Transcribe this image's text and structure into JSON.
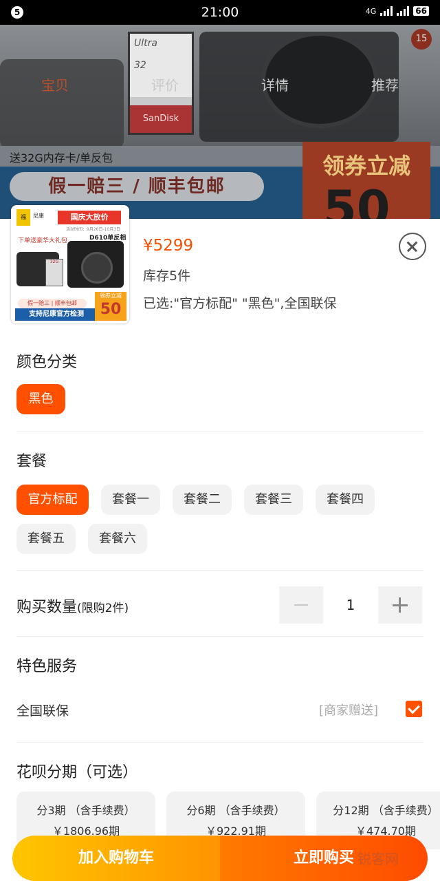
{
  "status_bar": {
    "badge": "5",
    "time": "21:00",
    "network": "4G",
    "battery": "66"
  },
  "background_page": {
    "sd_brand": "Ultra",
    "sd_size": "32",
    "sd_maker": "SanDisk",
    "cart_count": "15",
    "nav": [
      "宝贝",
      "评价",
      "详情",
      "推荐"
    ],
    "gift_line": "送32G内存卡/单反包",
    "promo_pill": "假一赔三 / 顺丰包邮",
    "coupon_title": "领券立减",
    "coupon_value": "50"
  },
  "product": {
    "thumb": {
      "logo": "福",
      "brand": "尼康",
      "banner": "国庆大放价",
      "date": "活动时间：9月26日-10月3日",
      "gift": "下单送豪华大礼包",
      "model": "D610单反相机",
      "sd": "32G",
      "tag1": "假一赔三 | 顺丰包邮",
      "tag2": "支持尼康官方检测",
      "coupon_label": "领券立减",
      "coupon_value": "50"
    },
    "price": "¥5299",
    "stock": "库存5件",
    "selected": "已选:\"官方标配\" \"黑色\",全国联保"
  },
  "color": {
    "title": "颜色分类",
    "options": [
      "黑色"
    ]
  },
  "package": {
    "title": "套餐",
    "options": [
      "官方标配",
      "套餐一",
      "套餐二",
      "套餐三",
      "套餐四",
      "套餐五",
      "套餐六"
    ]
  },
  "quantity": {
    "title": "购买数量",
    "limit": "(限购2件)",
    "value": "1"
  },
  "service": {
    "title": "特色服务",
    "label": "全国联保",
    "note": "[商家赠送]"
  },
  "installment": {
    "title": "花呗分期（可选）",
    "options": [
      {
        "period": "分3期 （含手续费）",
        "amount": "￥1806.96期"
      },
      {
        "period": "分6期 （含手续费）",
        "amount": "￥922.91期"
      },
      {
        "period": "分12期 （含手续费）",
        "amount": "￥474.70期"
      }
    ]
  },
  "actions": {
    "cart": "加入购物车",
    "buy": "立即购买"
  },
  "watermark": "锐客网"
}
